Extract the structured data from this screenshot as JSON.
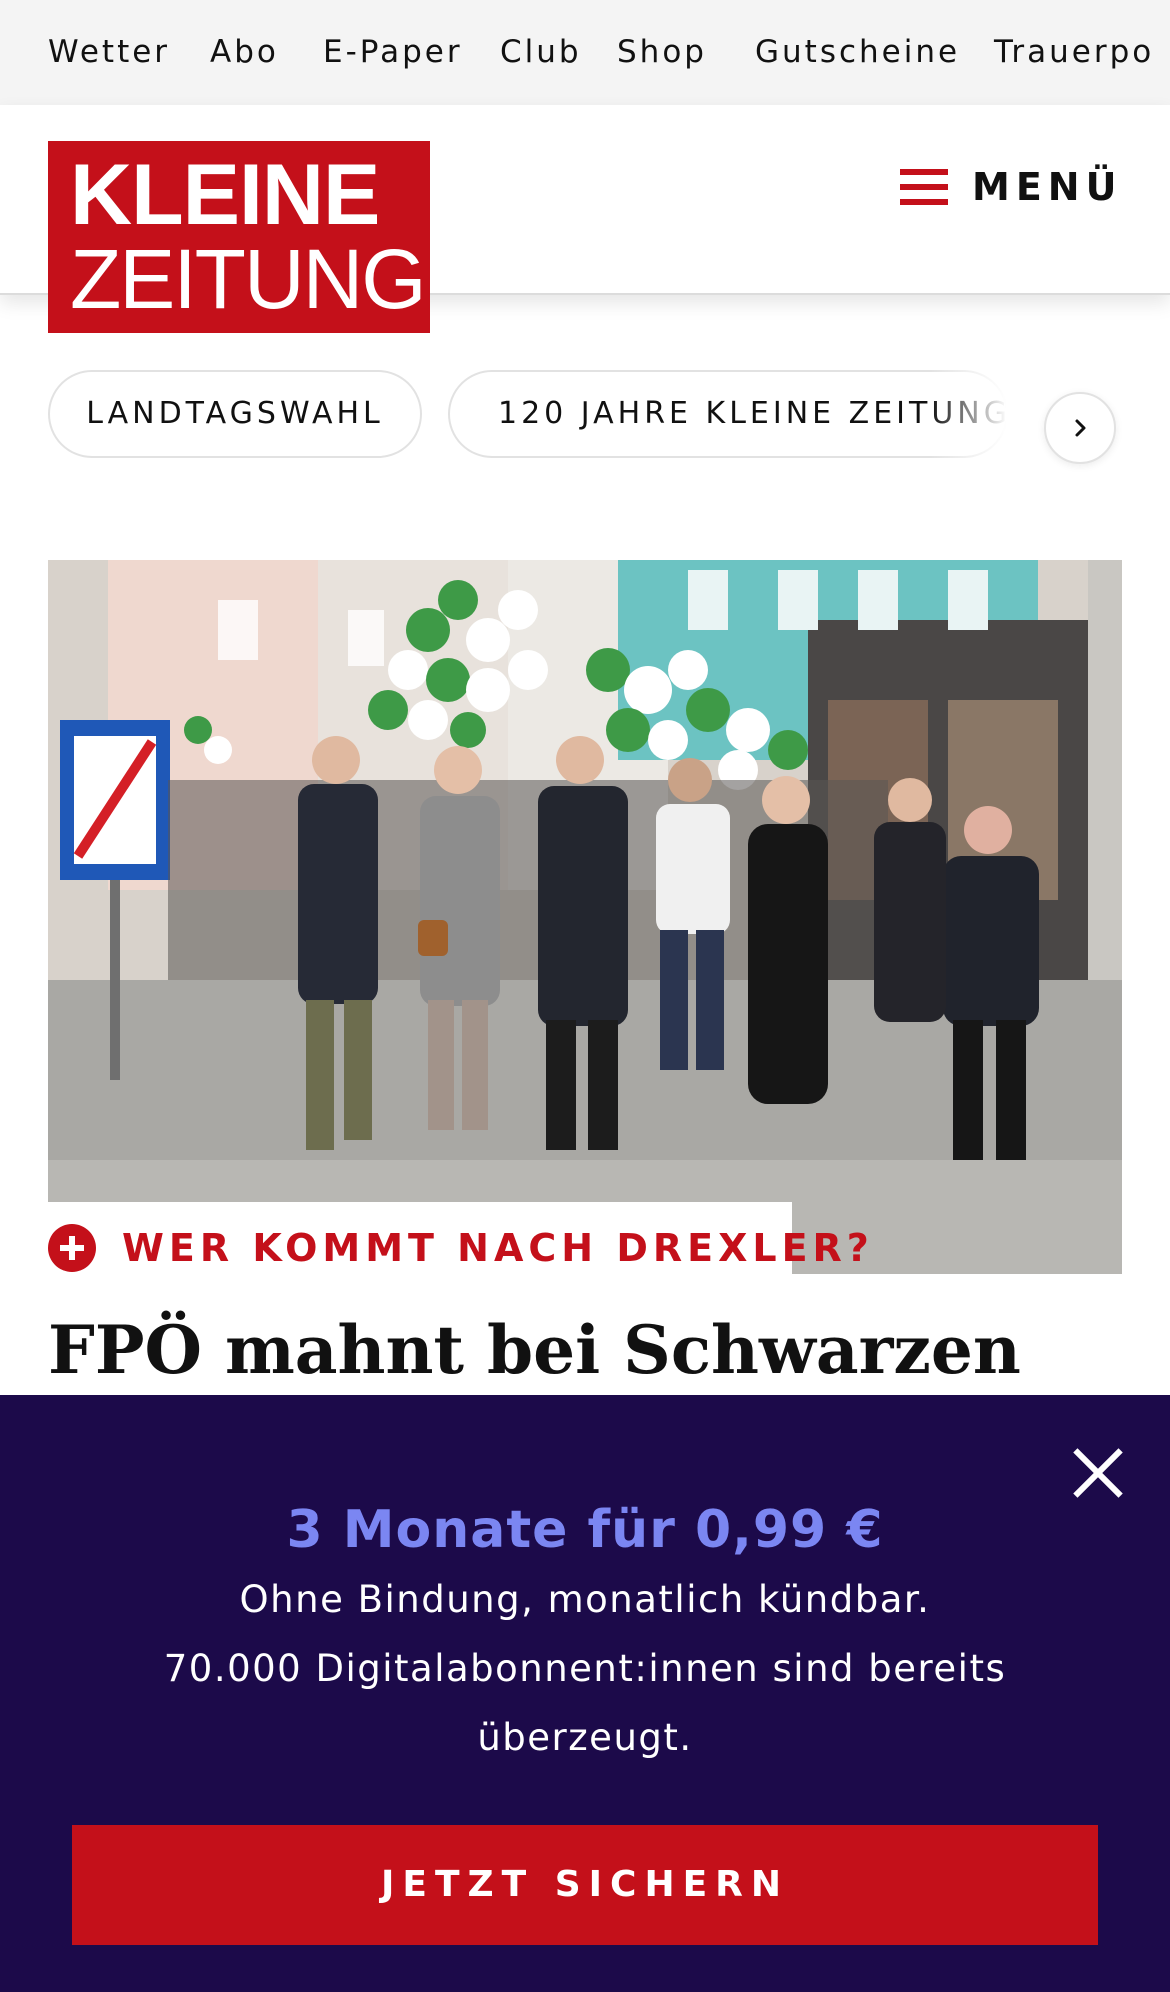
{
  "topnav": {
    "items": [
      "Wetter",
      "Abo",
      "E-Paper",
      "Club",
      "Shop",
      "Gutscheine",
      "Trauerpo"
    ]
  },
  "header": {
    "logo_line1": "KLEINE",
    "logo_line2": "ZEITUNG",
    "menu_label": "MENÜ",
    "brand_color": "#c4101a"
  },
  "chips": {
    "items": [
      "LANDTAGSWAHL",
      "120 JAHRE KLEINE ZEITUNG"
    ],
    "next_icon": "chevron-right-icon"
  },
  "article": {
    "kicker": "WER KOMMT NACH DREXLER?",
    "headline": "FPÖ mahnt bei Schwarzen"
  },
  "promo": {
    "title": "3 Monate für 0,99 €",
    "line1": "Ohne Bindung, monatlich kündbar.",
    "line2": "70.000 Digitalabonnent:innen sind bereits überzeugt.",
    "cta_label": "JETZT SICHERN",
    "background_color": "#1c0a4a",
    "accent_color": "#7b86f2"
  }
}
